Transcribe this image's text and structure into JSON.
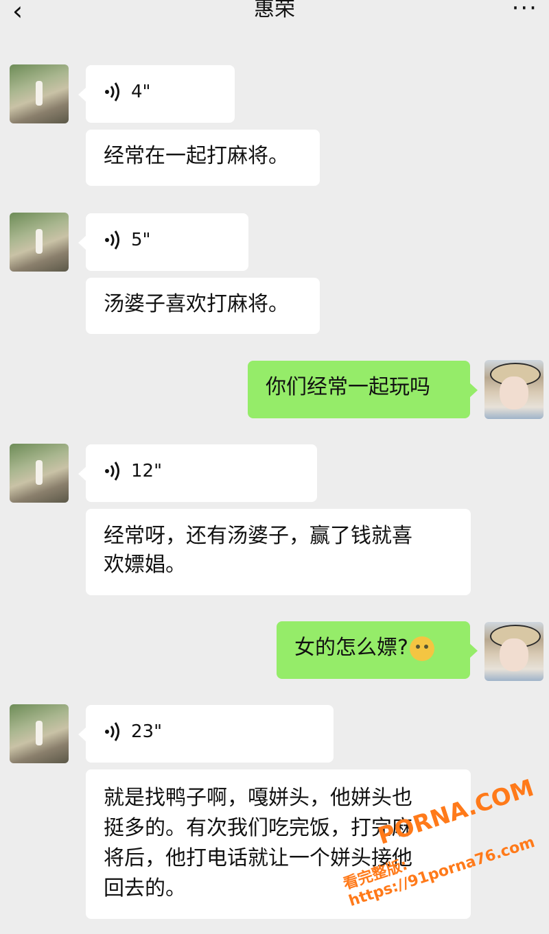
{
  "header": {
    "back_icon": "chevron-left-icon",
    "title": "惠荣",
    "more_icon": "more-dots-icon"
  },
  "messages": [
    {
      "side": "left",
      "type": "voice",
      "duration": "4\""
    },
    {
      "side": "left",
      "type": "text",
      "text": "经常在一起打麻将。"
    },
    {
      "side": "left",
      "type": "voice",
      "duration": "5\""
    },
    {
      "side": "left",
      "type": "text",
      "text": "汤婆子喜欢打麻将。"
    },
    {
      "side": "right",
      "type": "text",
      "text": "你们经常一起玩吗"
    },
    {
      "side": "left",
      "type": "voice",
      "duration": "12\""
    },
    {
      "side": "left",
      "type": "text",
      "line1": "经常呀，还有汤婆子，赢了钱就喜",
      "line2": "欢嫖娼。"
    },
    {
      "side": "right",
      "type": "text",
      "text": "女的怎么嫖?",
      "emoji": "flushed-face-emoji"
    },
    {
      "side": "left",
      "type": "voice",
      "duration": "23\""
    },
    {
      "side": "left",
      "type": "text",
      "line1": "就是找鸭子啊，嘎姘头，他姘头也",
      "line2": "挺多的。有次我们吃完饭，打完麻",
      "line3": "将后，他打电话就让一个姘头接他",
      "line4": "回去的。"
    }
  ],
  "watermark": {
    "brand": "PORNA.COM",
    "line": "看完整版: https://91porna76.com"
  },
  "colors": {
    "background": "#ededed",
    "incoming": "#ffffff",
    "outgoing": "#95ec69"
  }
}
